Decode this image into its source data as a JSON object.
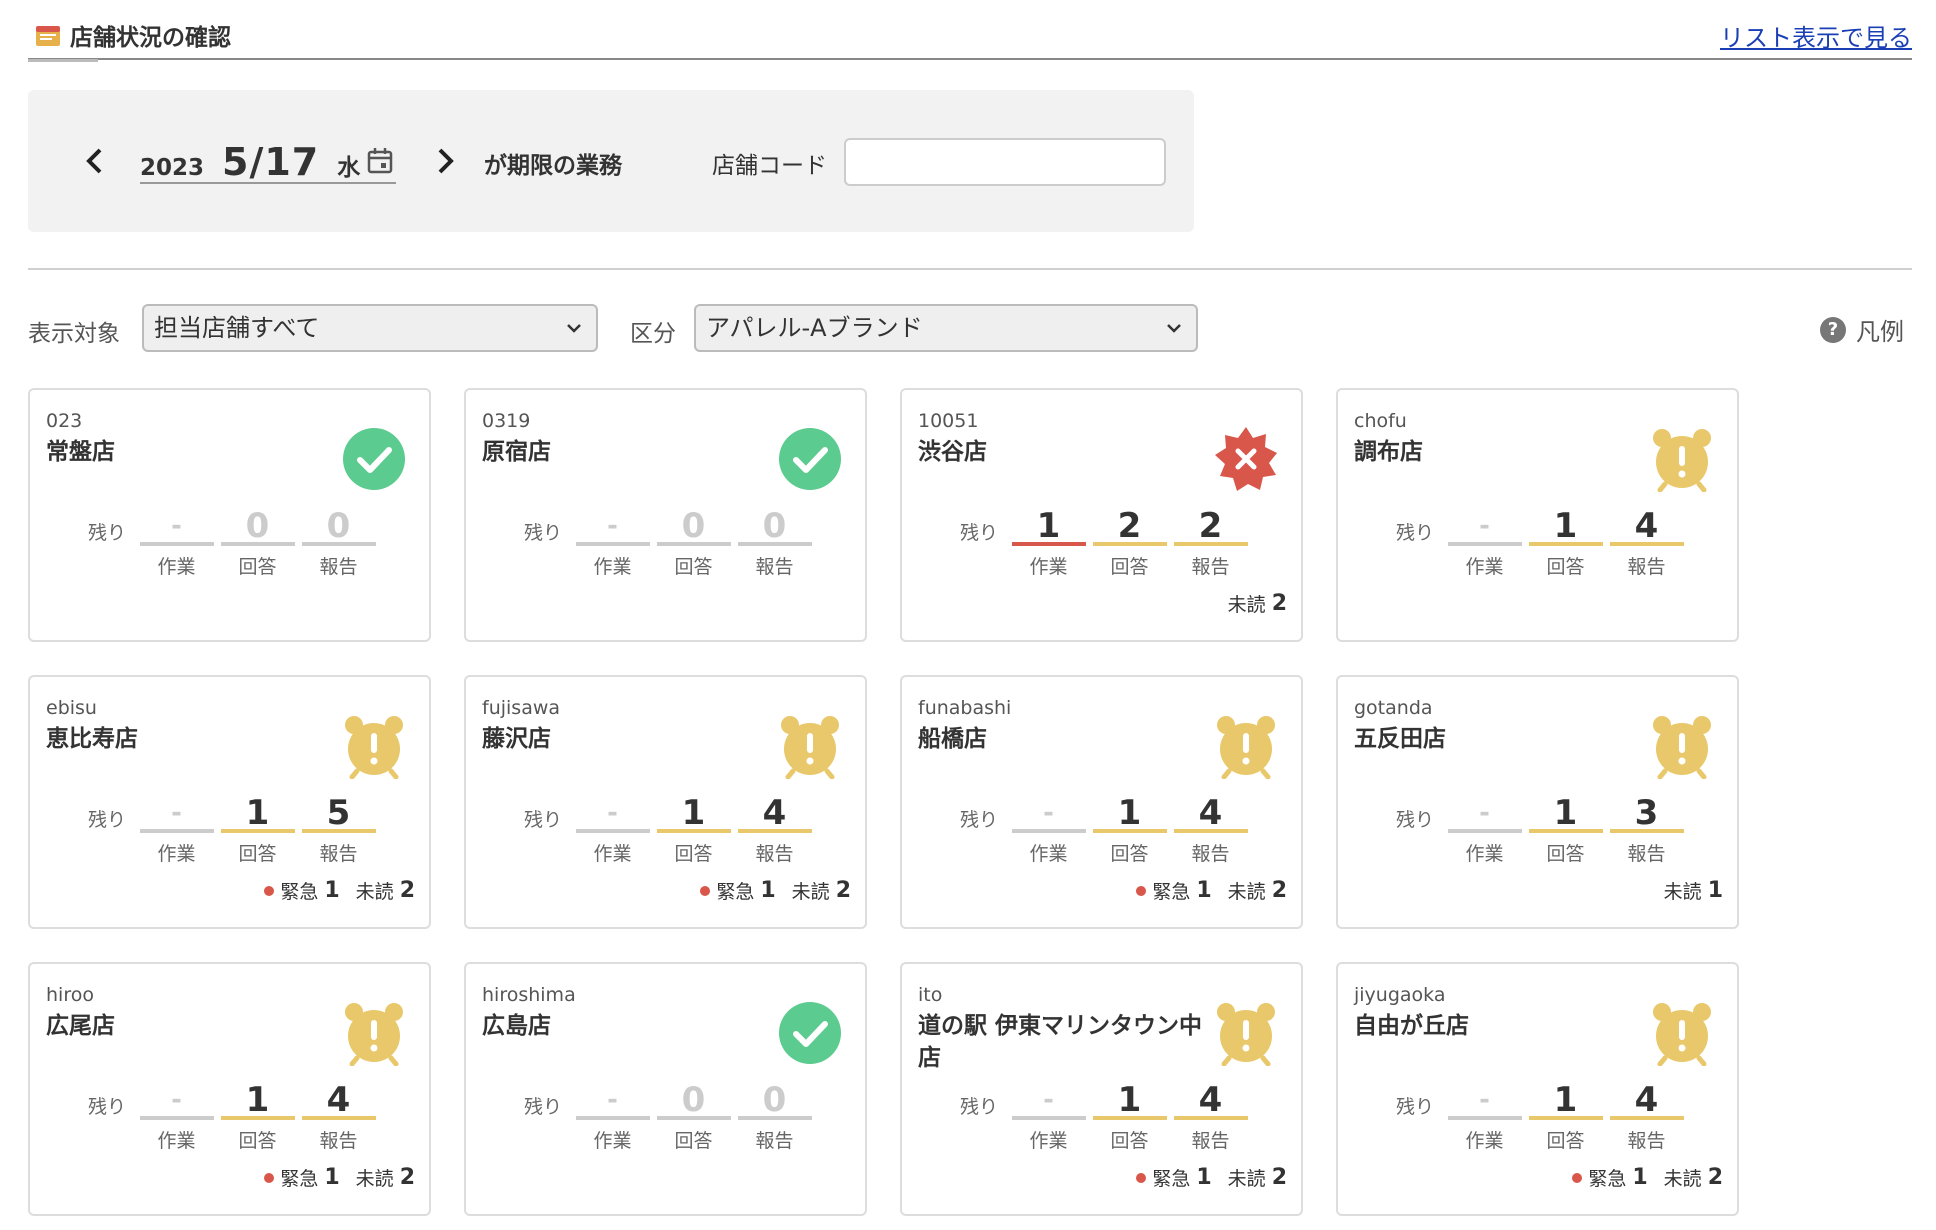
{
  "header": {
    "title": "店舗状況の確認",
    "list_link": "リスト表示で見る"
  },
  "date_panel": {
    "year": "2023",
    "month_day": "5/17",
    "weekday": "水",
    "deadline_label": "が期限の業務",
    "store_code_label": "店舗コード",
    "store_code_value": ""
  },
  "filters": {
    "target_label": "表示対象",
    "target_value": "担当店舗すべて",
    "category_label": "区分",
    "category_value": "アパレル-Aブランド",
    "legend_label": "凡例"
  },
  "card_labels": {
    "remain": "残り",
    "work": "作業",
    "answer": "回答",
    "report": "報告",
    "urgent": "緊急",
    "unread": "未読"
  },
  "colors": {
    "ok": "#5ccb8f",
    "alert": "#d9574a",
    "warn": "#e8c86a",
    "link": "#1a3fb5"
  },
  "stores": [
    {
      "code": "023",
      "name": "常盤店",
      "status": "ok",
      "work": "-",
      "answer": "0",
      "report": "0",
      "urgent": "",
      "unread": ""
    },
    {
      "code": "0319",
      "name": "原宿店",
      "status": "ok",
      "work": "-",
      "answer": "0",
      "report": "0",
      "urgent": "",
      "unread": ""
    },
    {
      "code": "10051",
      "name": "渋谷店",
      "status": "alert",
      "work": "1",
      "answer": "2",
      "report": "2",
      "urgent": "",
      "unread": "2"
    },
    {
      "code": "chofu",
      "name": "調布店",
      "status": "warn",
      "work": "-",
      "answer": "1",
      "report": "4",
      "urgent": "",
      "unread": ""
    },
    {
      "code": "ebisu",
      "name": "恵比寿店",
      "status": "warn",
      "work": "-",
      "answer": "1",
      "report": "5",
      "urgent": "1",
      "unread": "2"
    },
    {
      "code": "fujisawa",
      "name": "藤沢店",
      "status": "warn",
      "work": "-",
      "answer": "1",
      "report": "4",
      "urgent": "1",
      "unread": "2"
    },
    {
      "code": "funabashi",
      "name": "船橋店",
      "status": "warn",
      "work": "-",
      "answer": "1",
      "report": "4",
      "urgent": "1",
      "unread": "2"
    },
    {
      "code": "gotanda",
      "name": "五反田店",
      "status": "warn",
      "work": "-",
      "answer": "1",
      "report": "3",
      "urgent": "",
      "unread": "1"
    },
    {
      "code": "hiroo",
      "name": "広尾店",
      "status": "warn",
      "work": "-",
      "answer": "1",
      "report": "4",
      "urgent": "1",
      "unread": "2"
    },
    {
      "code": "hiroshima",
      "name": "広島店",
      "status": "ok",
      "work": "-",
      "answer": "0",
      "report": "0",
      "urgent": "",
      "unread": ""
    },
    {
      "code": "ito",
      "name": "道の駅 伊東マリンタウン中店",
      "status": "warn",
      "work": "-",
      "answer": "1",
      "report": "4",
      "urgent": "1",
      "unread": "2"
    },
    {
      "code": "jiyugaoka",
      "name": "自由が丘店",
      "status": "warn",
      "work": "-",
      "answer": "1",
      "report": "4",
      "urgent": "1",
      "unread": "2"
    }
  ]
}
